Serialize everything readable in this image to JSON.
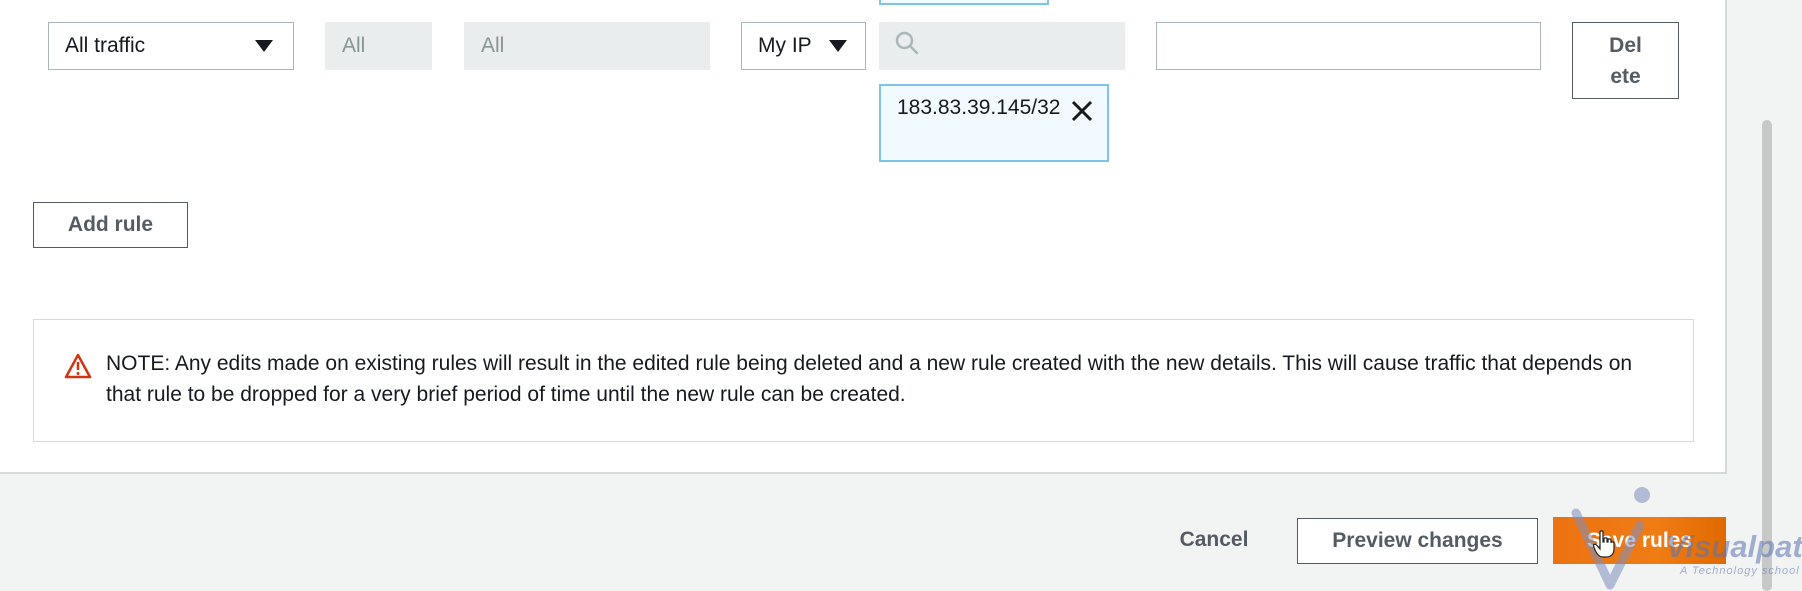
{
  "rule": {
    "type_value": "All traffic",
    "protocol_value": "All",
    "port_range_value": "All",
    "source_type_value": "My IP",
    "source_search_placeholder": "",
    "source_token": "183.83.39.145/32",
    "description_value": "",
    "delete_label": "Del ete"
  },
  "add_rule_label": "Add rule",
  "note": {
    "text": "NOTE: Any edits made on existing rules will result in the edited rule being deleted and a new rule created with the new details. This will cause traffic that depends on that rule to be dropped for a very brief period of time until the new rule can be created."
  },
  "footer": {
    "cancel_label": "Cancel",
    "preview_label": "Preview changes",
    "save_label": "Save rules"
  },
  "watermark": {
    "text": "Visualpath",
    "subtitle": "A Technology school"
  },
  "icons": {
    "search": "search-icon",
    "close": "close-icon",
    "warning": "warning-icon",
    "caret": "caret-down-icon"
  },
  "colors": {
    "save_button": "#ec7211",
    "token_border": "#7ec4e4",
    "token_bg": "#f1faff",
    "warning": "#d13212"
  }
}
